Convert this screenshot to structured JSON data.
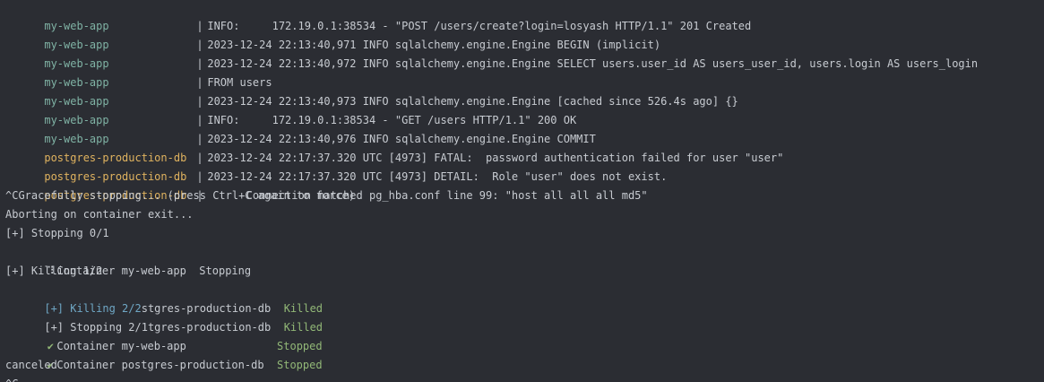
{
  "log_lines": [
    {
      "service": "my-web-app",
      "sep": "|",
      "text": "INFO:     172.19.0.1:38534 - \"POST /users/create?login=losyash HTTP/1.1\" 201 Created"
    },
    {
      "service": "my-web-app",
      "sep": "|",
      "text": "2023-12-24 22:13:40,971 INFO sqlalchemy.engine.Engine BEGIN (implicit)"
    },
    {
      "service": "my-web-app",
      "sep": "|",
      "text": "2023-12-24 22:13:40,972 INFO sqlalchemy.engine.Engine SELECT users.user_id AS users_user_id, users.login AS users_login"
    },
    {
      "service": "my-web-app",
      "sep": "|",
      "text": "FROM users"
    },
    {
      "service": "my-web-app",
      "sep": "|",
      "text": "2023-12-24 22:13:40,973 INFO sqlalchemy.engine.Engine [cached since 526.4s ago] {}"
    },
    {
      "service": "my-web-app",
      "sep": "|",
      "text": "INFO:     172.19.0.1:38534 - \"GET /users HTTP/1.1\" 200 OK"
    },
    {
      "service": "my-web-app",
      "sep": "|",
      "text": "2023-12-24 22:13:40,976 INFO sqlalchemy.engine.Engine COMMIT"
    },
    {
      "service": "postgres-production-db",
      "sep": "|",
      "text": "2023-12-24 22:17:37.320 UTC [4973] FATAL:  password authentication failed for user \"user\""
    },
    {
      "service": "postgres-production-db",
      "sep": "|",
      "text": "2023-12-24 22:17:37.320 UTC [4973] DETAIL:  Role \"user\" does not exist."
    },
    {
      "service": "postgres-production-db",
      "sep": "|",
      "text": "      Connection matched pg_hba.conf line 99: \"host all all all md5\""
    }
  ],
  "shutdown": {
    "graceful": "^CGracefully stopping... (press Ctrl+C again to force)",
    "aborting": "Aborting on container exit...",
    "stopping_01": "[+] Stopping 0/1",
    "container_web_stopping": "Container my-web-app  Stopping",
    "killing_12": "[+] Killing 1/2",
    "killing_22_prefix": "[+] Killing 2/2",
    "killing_22_overlap": "stgres-production-db",
    "killed_1": "Killed",
    "stopping_21_prefix": "[+] Stopping 2/1",
    "stopping_21_overlap": "tgres-production-db",
    "killed_2": "Killed",
    "container_web": "Container my-web-app",
    "stopped_1": "Stopped",
    "container_db": "Container postgres-production-db",
    "stopped_2": "Stopped",
    "canceled": "canceled",
    "partial_line": "^C"
  },
  "colors": {
    "background": "#2b2d33",
    "web_service": "#7fb2a4",
    "db_service": "#e0b35f",
    "status_green": "#92b877",
    "progress_cyan": "#6fa7c5"
  },
  "icons": {
    "spinner": "spinner-icon",
    "check": "check-icon"
  }
}
